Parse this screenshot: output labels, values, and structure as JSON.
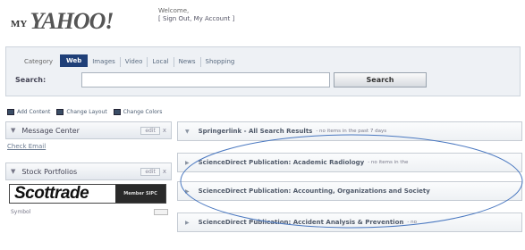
{
  "header": {
    "logo_my": "MY",
    "logo_yahoo": "YAHOO!",
    "welcome": "Welcome,",
    "signout": "[ Sign Out, My Account ]"
  },
  "search": {
    "tabs": [
      {
        "label": "Category",
        "active": false
      },
      {
        "label": "Web",
        "active": true
      },
      {
        "label": "Images",
        "active": false
      },
      {
        "label": "Video",
        "active": false
      },
      {
        "label": "Local",
        "active": false
      },
      {
        "label": "News",
        "active": false
      },
      {
        "label": "Shopping",
        "active": false
      }
    ],
    "label": "Search:",
    "value": "",
    "button": "Search"
  },
  "toolbar": {
    "add_content": "Add Content",
    "change_layout": "Change Layout",
    "change_colors": "Change Colors"
  },
  "left_column": {
    "message_center": {
      "title": "Message Center",
      "edit": "edit",
      "close": "x",
      "link": "Check Email"
    },
    "stock_portfolios": {
      "title": "Stock Portfolios",
      "edit": "edit",
      "close": "x"
    },
    "ad": {
      "brand": "Scottrade",
      "promo": "Member SIPC"
    },
    "symbol_label": "Symbol"
  },
  "feeds": [
    {
      "name": "Springerlink - All Search Results",
      "meta": "- no items in the past 7 days"
    },
    {
      "name": "ScienceDirect Publication: Academic Radiology",
      "meta": "- no items in the"
    },
    {
      "name": "ScienceDirect Publication: Accounting, Organizations and Society",
      "meta": ""
    },
    {
      "name": "ScienceDirect Publication: Accident Analysis & Prevention",
      "meta": "- no"
    }
  ],
  "annotation": {
    "color": "#4a78c0"
  }
}
